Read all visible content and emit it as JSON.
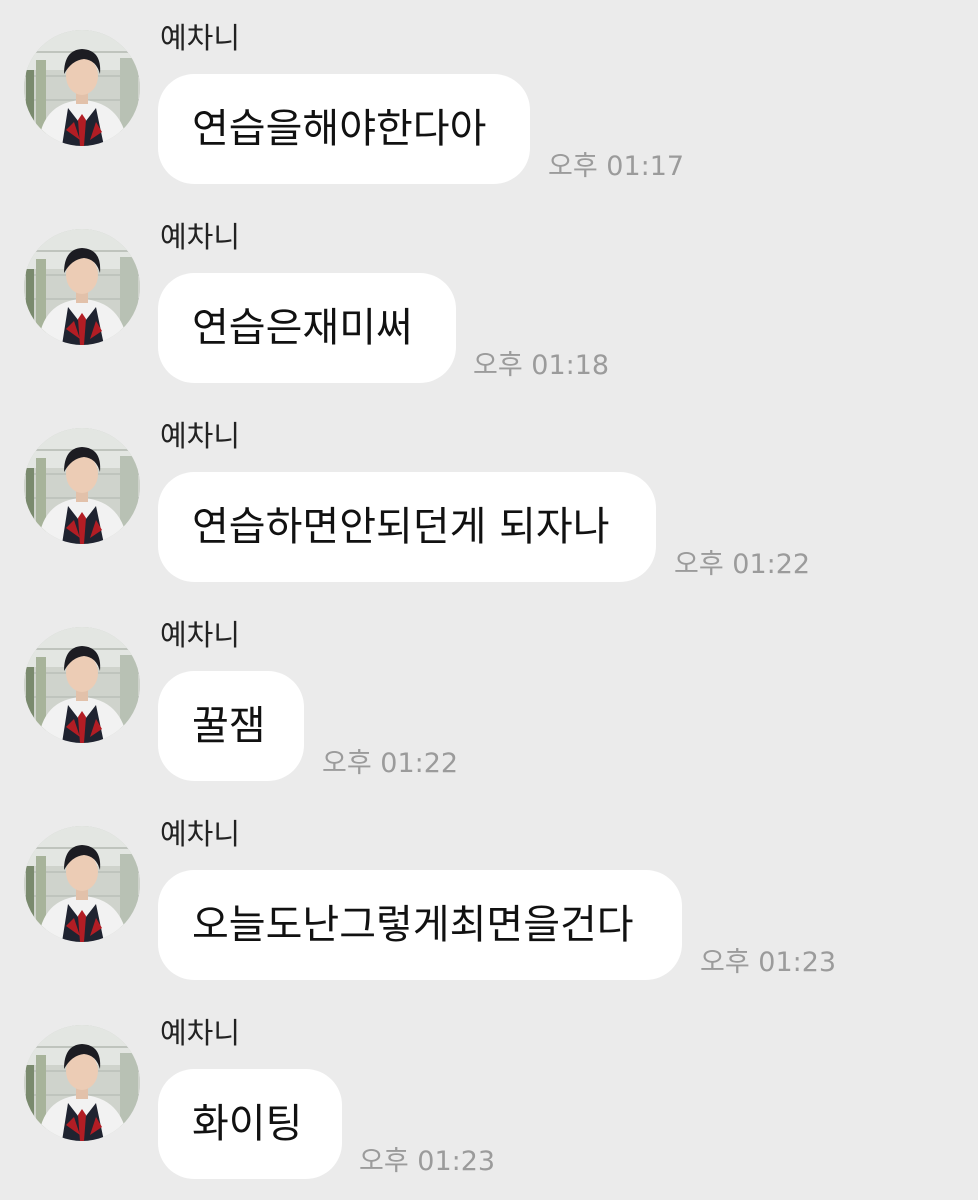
{
  "sender_name": "예차니",
  "colors": {
    "background": "#ebebeb",
    "bubble": "#ffffff",
    "time_text": "#9b9b9b"
  },
  "messages": [
    {
      "text": "연습을해야한다아",
      "time": "오후 01:17"
    },
    {
      "text": "연습은재미써",
      "time": "오후 01:18"
    },
    {
      "text": "연습하면안되던게 되자나",
      "time": "오후 01:22"
    },
    {
      "text": "꿀잼",
      "time": "오후 01:22"
    },
    {
      "text": "오늘도난그렇게최면을건다",
      "time": "오후 01:23"
    },
    {
      "text": "화이팅",
      "time": "오후 01:23"
    }
  ]
}
